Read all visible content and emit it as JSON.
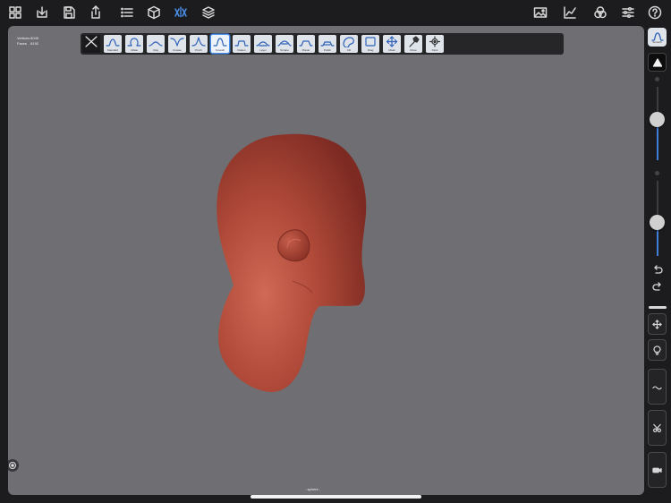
{
  "stats": {
    "vertices_label": "Vertices",
    "vertices_value": "8049",
    "faces_label": "Faces",
    "faces_value": "8192"
  },
  "top_toolbar": {
    "left_icons": [
      "grid-icon",
      "import-icon",
      "save-icon",
      "share-icon",
      "list-icon",
      "cube-icon",
      "symmetry-icon",
      "layers-icon"
    ],
    "right_icons": [
      "image-icon",
      "graph-icon",
      "color-circles-icon",
      "sliders-icon",
      "help-icon"
    ]
  },
  "tools": [
    {
      "label": "Close",
      "icon": "close-icon"
    },
    {
      "label": "Standard",
      "icon": "standard-brush-icon"
    },
    {
      "label": "Inflate",
      "icon": "inflate-brush-icon"
    },
    {
      "label": "Clay",
      "icon": "clay-brush-icon"
    },
    {
      "label": "Crease",
      "icon": "crease-brush-icon"
    },
    {
      "label": "Pinch",
      "icon": "pinch-brush-icon"
    },
    {
      "label": "Smooth",
      "icon": "smooth-brush-icon"
    },
    {
      "label": "Flatten",
      "icon": "flatten-brush-icon"
    },
    {
      "label": "Layer",
      "icon": "layer-brush-icon"
    },
    {
      "label": "Scrape",
      "icon": "scrape-brush-icon"
    },
    {
      "label": "Planar",
      "icon": "planar-brush-icon"
    },
    {
      "label": "Polish",
      "icon": "polish-brush-icon"
    },
    {
      "label": "Fill",
      "icon": "fill-brush-icon"
    },
    {
      "label": "Drag",
      "icon": "drag-brush-icon"
    },
    {
      "label": "Mask",
      "icon": "mask-icon"
    },
    {
      "label": "Move",
      "icon": "move-icon"
    },
    {
      "label": "Paint",
      "icon": "paint-icon"
    },
    {
      "label": "Transform",
      "icon": "transform-icon"
    }
  ],
  "active_tool": "Smooth",
  "current_brush_label": "Smooth",
  "viewport_label": "sphere",
  "sliders": {
    "radius": 0.55,
    "intensity": 0.45
  },
  "colors": {
    "accent": "#3f7fd9",
    "mesh": "#b5503f",
    "viewport_bg": "#6f6e73"
  }
}
